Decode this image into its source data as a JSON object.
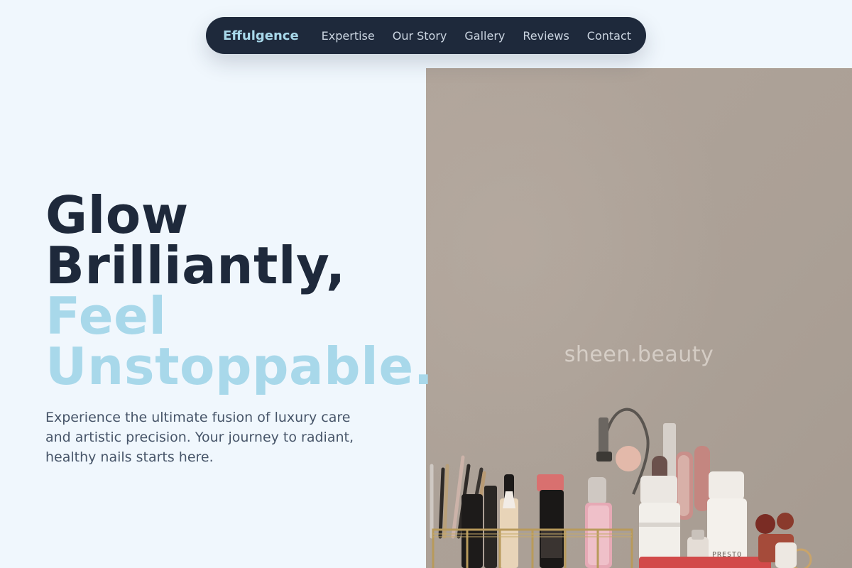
{
  "nav": {
    "brand": "Effulgence",
    "links": [
      "Expertise",
      "Our Story",
      "Gallery",
      "Reviews",
      "Contact"
    ]
  },
  "hero": {
    "headline_dark": [
      "Glow",
      "Brilliantly,"
    ],
    "headline_light": [
      "Feel",
      "Unstoppable."
    ],
    "description": "Experience the ultimate fusion of luxury care and artistic precision. Your journey to radiant, healthy nails starts here."
  },
  "photo": {
    "watermark": "sheen.beauty",
    "label_presto": "PRESTO"
  },
  "colors": {
    "background": "#f0f7fd",
    "nav_bg": "#1e293b",
    "accent": "#a8d8ea",
    "headline_dark": "#1e293b",
    "body_text": "#475569"
  }
}
